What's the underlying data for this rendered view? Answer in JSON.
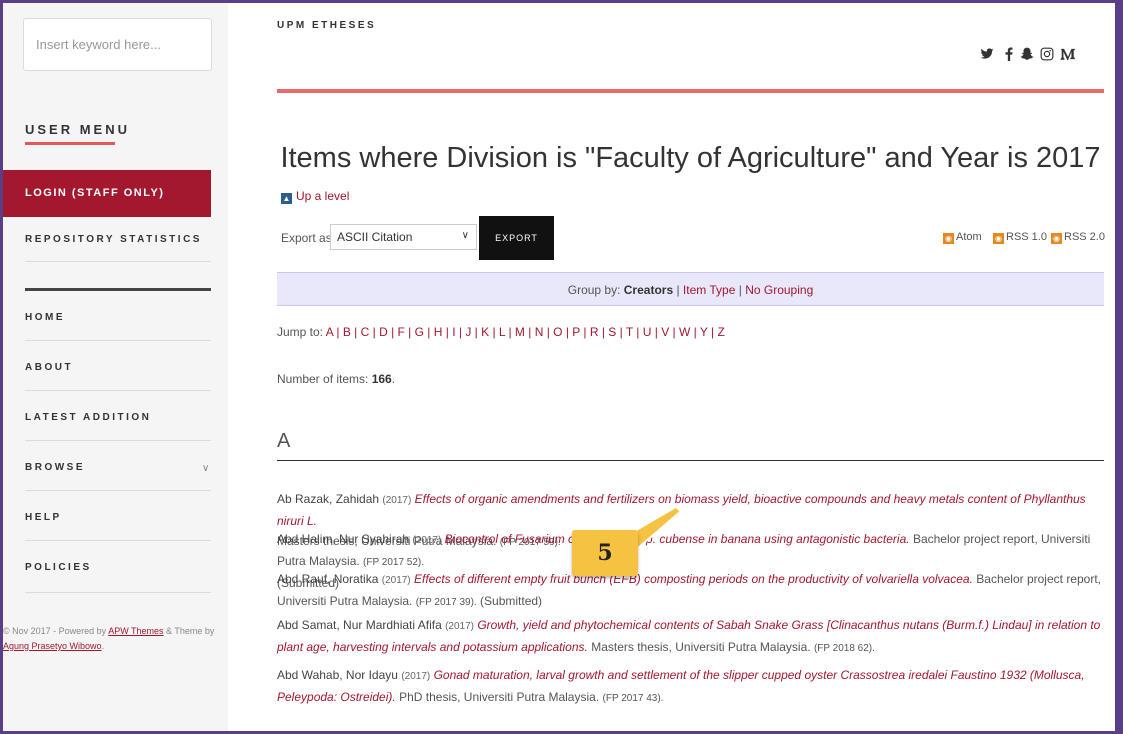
{
  "sidebar": {
    "search_placeholder": "Insert keyword here...",
    "user_menu_title": "USER MENU",
    "login_label": "LOGIN (STAFF ONLY)",
    "repo_stats_label": "REPOSITORY STATISTICS",
    "nav": [
      {
        "label": "HOME"
      },
      {
        "label": "ABOUT"
      },
      {
        "label": "LATEST ADDITION"
      },
      {
        "label": "BROWSE"
      },
      {
        "label": "HELP"
      },
      {
        "label": "POLICIES"
      }
    ],
    "footer": {
      "prefix": "© Nov 2017 - Powered by ",
      "apw": "APW Themes",
      "mid": " & Theme by ",
      "author": "Agung Prasetyo Wibowo",
      "suffix": "."
    }
  },
  "header": {
    "brand": "UPM ETHESES",
    "social_icons": [
      "twitter-icon",
      "facebook-icon",
      "snapchat-icon",
      "instagram-icon",
      "medium-icon"
    ]
  },
  "main": {
    "title": "Items where Division is \"Faculty of Agriculture\" and Year is 2017",
    "up_level": "Up a level",
    "export_label": "Export as",
    "export_format": "ASCII Citation",
    "export_button": "EXPORT",
    "feeds": [
      "Atom",
      "RSS 1.0",
      "RSS 2.0"
    ],
    "group_by": {
      "prefix": "Group by: ",
      "current": "Creators",
      "sep1": " | ",
      "item_type": "Item Type",
      "sep2": " | ",
      "no_grouping": "No Grouping"
    },
    "jump_prefix": "Jump to: ",
    "jump_letters": "A | B | C | D | F | G | H | I | J | K | L | M | N | O | P | R | S | T | U | V | W | Y | Z",
    "count_prefix": "Number of items: ",
    "count": "166",
    "count_suffix": ".",
    "section": "A",
    "items": [
      {
        "author": "Ab Razak, Zahidah",
        "year": "(2017)",
        "title": "Effects of organic amendments and fertilizers on biomass yield, bioactive compounds and heavy metals content of Phyllanthus niruri L.",
        "rest": "Masters thesis, Universiti Putra Malaysia.",
        "ref": "(FP 2017 59)."
      },
      {
        "author": "Abd Halim, Nur Syahirah",
        "year": "(2017)",
        "title": "Biocontrol of Fusarium oxysporum f. sp. cubense in banana using antagonistic bacteria.",
        "rest": "Bachelor project report, Universiti Putra Malaysia.",
        "ref": "(FP 2017 52).",
        "extra": "(Submitted)"
      },
      {
        "author": "Abd Rauf, Noratika",
        "year": "(2017)",
        "title": "Effects of different empty fruit bunch (EFB) composting periods on the productivity of volvariella volvacea.",
        "rest": "Bachelor project report, Universiti Putra Malaysia.",
        "ref": "(FP 2017 39).",
        "extra": "(Submitted)"
      },
      {
        "author": "Abd Samat, Nur Mardhiati Afifa",
        "year": "(2017)",
        "title": "Growth, yield and phytochemical contents of Sabah Snake Grass [Clinacanthus nutans (Burm.f.) Lindau] in relation to plant age, harvesting intervals and potassium applications.",
        "rest": "Masters thesis, Universiti Putra Malaysia.",
        "ref": "(FP 2018 62)."
      },
      {
        "author": "Abd Wahab, Nor Idayu",
        "year": "(2017)",
        "title": "Gonad maturation, larval growth and settlement of the slipper cupped oyster Crassostrea iredalei Faustino 1932 (Mollusca, Peleypoda: Ostreidei).",
        "rest": "PhD thesis, Universiti Putra Malaysia.",
        "ref": "(FP 2017 43)."
      }
    ]
  },
  "annotation": {
    "badge": "5",
    "color": "#f5c242"
  },
  "colors": {
    "accent": "#a3172f",
    "rule": "#e86a6a",
    "frame": "#5b3e88"
  }
}
